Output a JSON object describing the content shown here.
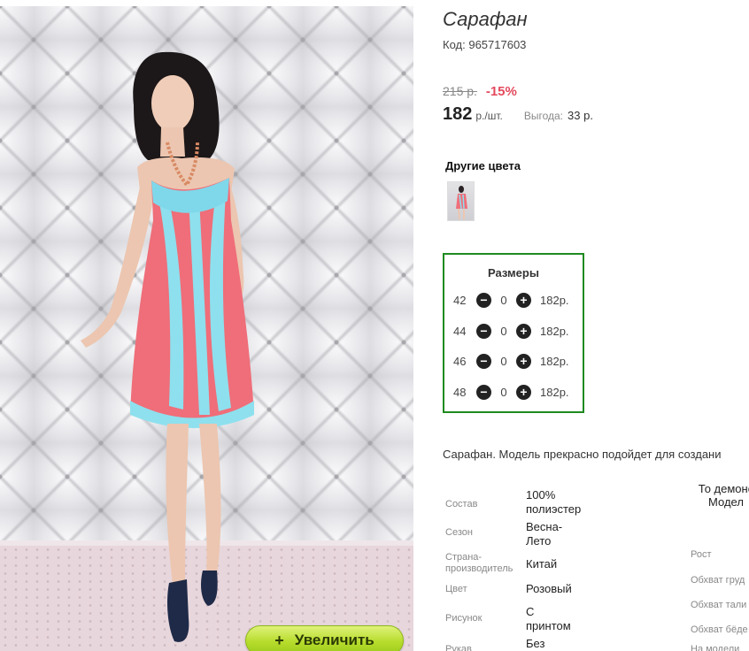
{
  "product": {
    "title": "Сарафан",
    "sku_label": "Код:",
    "sku": "965717603",
    "old_price": "215 р.",
    "discount": "-15%",
    "price": "182",
    "price_unit": "р./шт.",
    "savings_label": "Выгода:",
    "savings_value": "33 р."
  },
  "gallery": {
    "zoom_label": "Увеличить"
  },
  "other_colors": {
    "title": "Другие цвета"
  },
  "sizes": {
    "title": "Размеры",
    "rows": [
      {
        "size": "42",
        "qty": "0",
        "price": "182р."
      },
      {
        "size": "44",
        "qty": "0",
        "price": "182р."
      },
      {
        "size": "46",
        "qty": "0",
        "price": "182р."
      },
      {
        "size": "48",
        "qty": "0",
        "price": "182р."
      }
    ]
  },
  "description": "Сарафан. Модель прекрасно подойдет для создани",
  "specs": [
    {
      "label": "Состав",
      "value": "100% полиэстер"
    },
    {
      "label": "Сезон",
      "value": "Весна-Лето"
    },
    {
      "label": "Страна-производитель",
      "value": "Китай"
    },
    {
      "label": "Цвет",
      "value": "Розовый"
    },
    {
      "label": "Рисунок",
      "value": "С принтом"
    },
    {
      "label": "Рукав",
      "value": "Без"
    }
  ],
  "measurements": {
    "header": "То демонс Модел",
    "labels": [
      "Рост",
      "Обхват груд",
      "Обхват тали",
      "Обхват бёде",
      "На модели"
    ]
  },
  "colors": {
    "accent_green": "#1f8a1f",
    "discount_red": "#e34a5e",
    "zoom_green": "#b7dc2c"
  }
}
